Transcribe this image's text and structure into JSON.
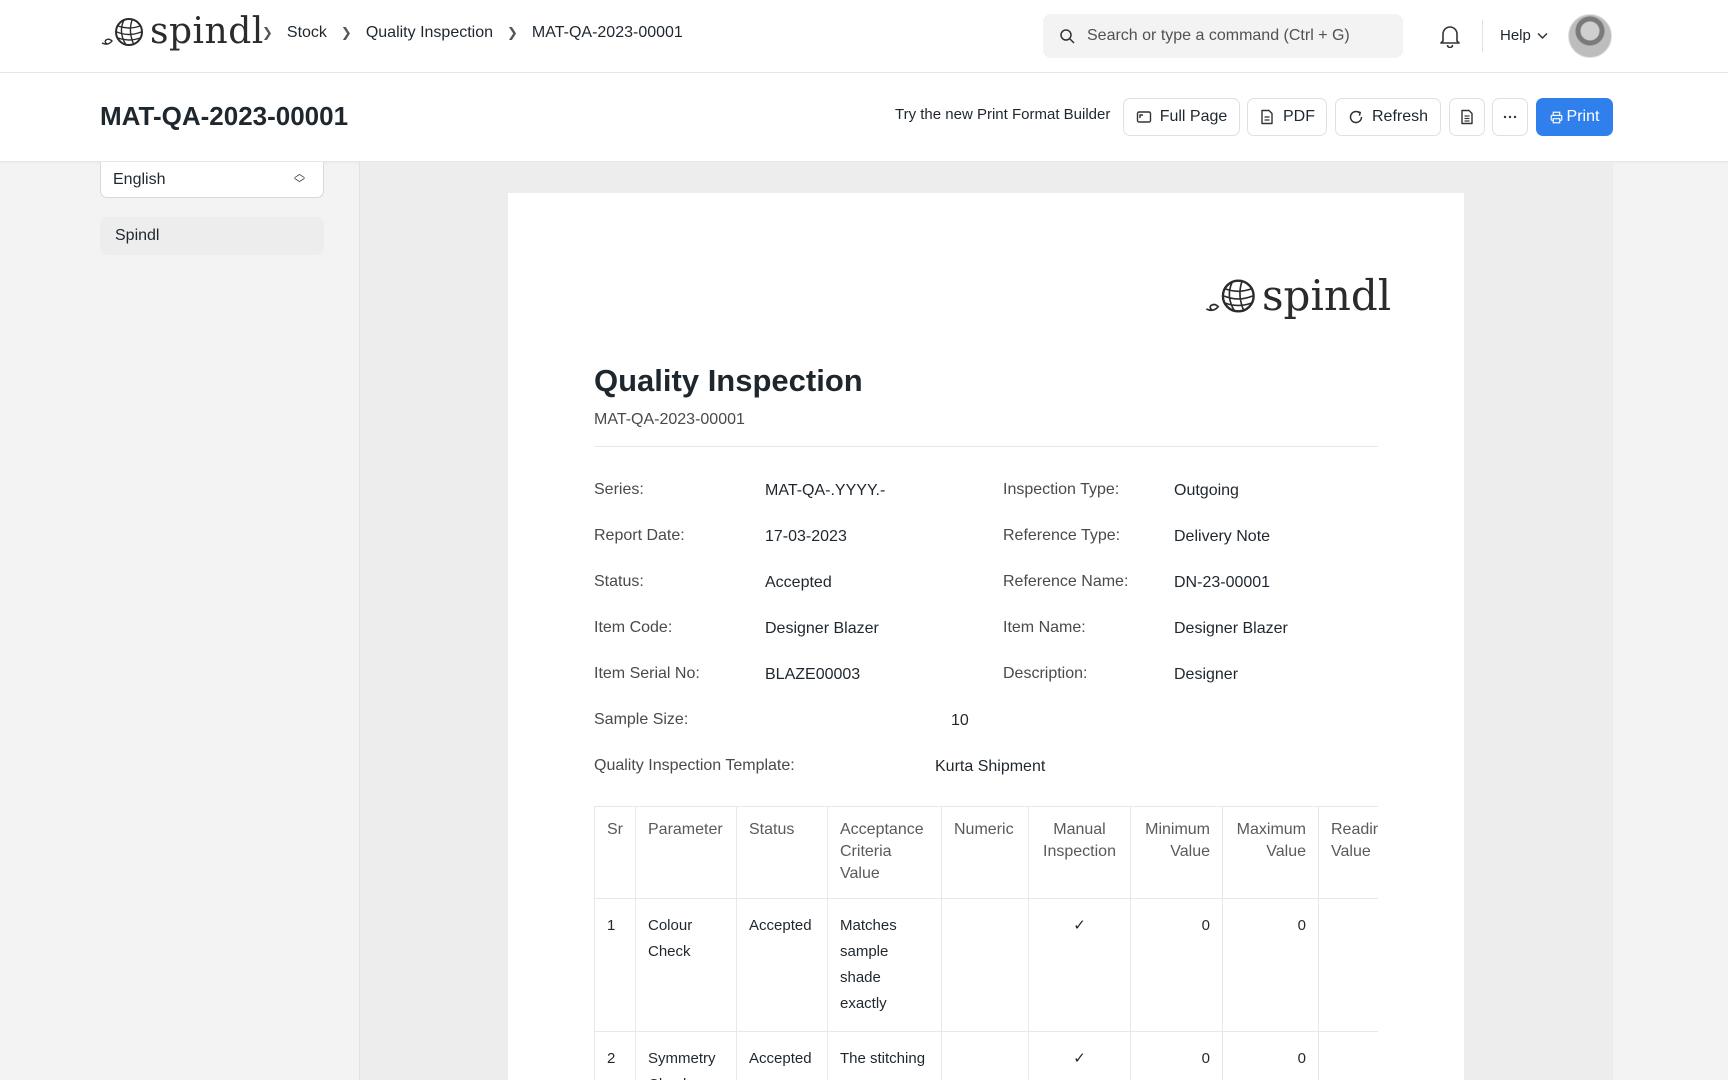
{
  "app": {
    "brand": "spindl"
  },
  "breadcrumbs": [
    "Stock",
    "Quality Inspection",
    "MAT-QA-2023-00001"
  ],
  "search": {
    "placeholder": "Search or type a command (Ctrl + G)"
  },
  "help_label": "Help",
  "page": {
    "title": "MAT-QA-2023-00001",
    "try_link": "Try the new Print Format Builder",
    "buttons": {
      "full_page": "Full Page",
      "pdf": "PDF",
      "refresh": "Refresh",
      "print": "Print"
    }
  },
  "sidebar": {
    "language": "English",
    "letterhead": "Spindl"
  },
  "doc": {
    "logo": "spindl",
    "title": "Quality Inspection",
    "name": "MAT-QA-2023-00001",
    "fields": {
      "series": {
        "label": "Series:",
        "value": "MAT-QA-.YYYY.-"
      },
      "inspection_type": {
        "label": "Inspection Type:",
        "value": "Outgoing"
      },
      "report_date": {
        "label": "Report Date:",
        "value": "17-03-2023"
      },
      "reference_type": {
        "label": "Reference Type:",
        "value": "Delivery Note"
      },
      "status": {
        "label": "Status:",
        "value": "Accepted"
      },
      "reference_name": {
        "label": "Reference Name:",
        "value": "DN-23-00001"
      },
      "item_code": {
        "label": "Item Code:",
        "value": "Designer Blazer"
      },
      "item_name": {
        "label": "Item Name:",
        "value": "Designer Blazer"
      },
      "item_serial_no": {
        "label": "Item Serial No:",
        "value": "BLAZE00003"
      },
      "description": {
        "label": "Description:",
        "value": "Designer"
      },
      "sample_size": {
        "label": "Sample Size:",
        "value": "10"
      },
      "template": {
        "label": "Quality Inspection Template:",
        "value": "Kurta Shipment"
      }
    },
    "table": {
      "headers": {
        "sr": "Sr",
        "parameter": "Parameter",
        "status": "Status",
        "acceptance": "Acceptance Criteria Value",
        "numeric": "Numeric",
        "manual": "Manual Inspection",
        "min": "Minimum Value",
        "max": "Maximum Value",
        "reading": "Reading Value"
      },
      "rows": [
        {
          "sr": "1",
          "parameter": "Colour Check",
          "status": "Accepted",
          "acceptance": "Matches sample shade exactly",
          "numeric": "",
          "manual": "✓",
          "min": "0",
          "max": "0",
          "reading": ""
        },
        {
          "sr": "2",
          "parameter": "Symmetry Check",
          "status": "Accepted",
          "acceptance": "The stitching",
          "numeric": "",
          "manual": "✓",
          "min": "0",
          "max": "0",
          "reading": ""
        }
      ]
    }
  }
}
